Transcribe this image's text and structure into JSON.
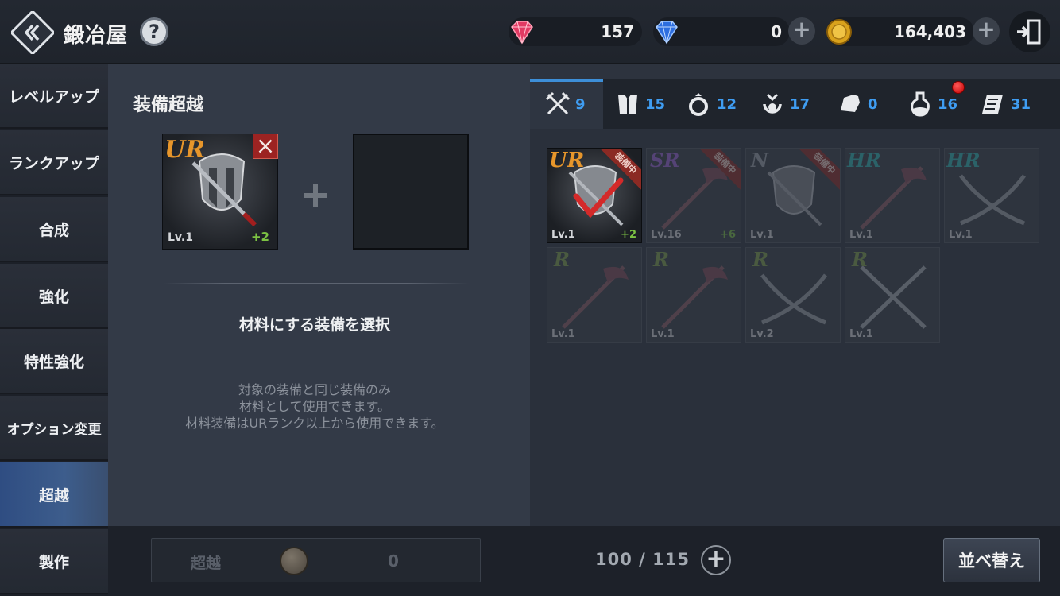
{
  "header": {
    "title": "鍛冶屋",
    "help": "?",
    "currencies": [
      {
        "icon": "red-gem-icon",
        "value": "157"
      },
      {
        "icon": "blue-gem-icon",
        "value": "0"
      },
      {
        "icon": "gold-coin-icon",
        "value": "164,403"
      }
    ]
  },
  "sidebar": {
    "items": [
      {
        "label": "レベルアップ"
      },
      {
        "label": "ランクアップ"
      },
      {
        "label": "合成"
      },
      {
        "label": "強化"
      },
      {
        "label": "特性強化"
      },
      {
        "label": "オプション変更"
      },
      {
        "label": "超越",
        "active": true
      },
      {
        "label": "製作"
      }
    ]
  },
  "main": {
    "section_title": "装備超越",
    "base_item": {
      "rank": "UR",
      "level": "Lv.1",
      "plus": "+2"
    },
    "instruction": "材料にする装備を選択",
    "note_lines": [
      "対象の装備と同じ装備のみ",
      "材料として使用できます。",
      "材料装備はURランク以上から使用できます。"
    ]
  },
  "tabs": [
    {
      "icon": "crossed-swords-icon",
      "count": "9"
    },
    {
      "icon": "armor-icon",
      "count": "15"
    },
    {
      "icon": "ring-icon",
      "count": "12"
    },
    {
      "icon": "amulet-icon",
      "count": "17"
    },
    {
      "icon": "glove-icon",
      "count": "0"
    },
    {
      "icon": "potion-icon",
      "count": "16"
    },
    {
      "icon": "scroll-icon",
      "count": "31"
    }
  ],
  "inventory": [
    {
      "rank": "UR",
      "level": "Lv.1",
      "plus": "+2",
      "equipped": "装備中",
      "selected": true
    },
    {
      "rank": "SR",
      "level": "Lv.16",
      "plus": "+6",
      "equipped": "装備中"
    },
    {
      "rank": "N",
      "level": "Lv.1",
      "plus": "",
      "equipped": "装備中"
    },
    {
      "rank": "HR",
      "level": "Lv.1",
      "plus": ""
    },
    {
      "rank": "HR",
      "level": "Lv.1",
      "plus": ""
    },
    {
      "rank": "R",
      "level": "Lv.1",
      "plus": ""
    },
    {
      "rank": "R",
      "level": "Lv.1",
      "plus": ""
    },
    {
      "rank": "R",
      "level": "Lv.2",
      "plus": ""
    },
    {
      "rank": "R",
      "level": "Lv.1",
      "plus": ""
    }
  ],
  "bottom": {
    "transcend_label": "超越",
    "cost": "0",
    "capacity": "100 / 115",
    "sort_label": "並べ替え"
  },
  "colors": {
    "accent_blue": "#3f9df2",
    "active_tab": "#3d5d8c",
    "rank_UR": "#e7962b",
    "rank_SR": "#9b62d6",
    "rank_HR": "#2fb3b1",
    "rank_R": "#7fa04a",
    "rank_N": "#9aa0a8",
    "plus_green": "#7cc243"
  }
}
